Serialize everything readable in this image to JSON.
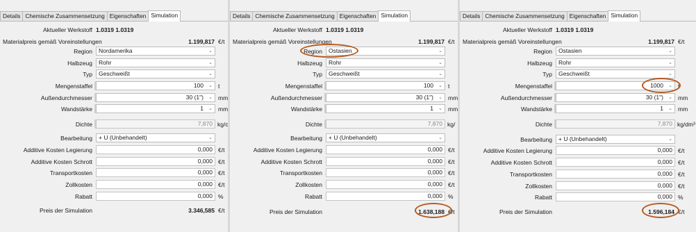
{
  "tabs": [
    "Details",
    "Chemische Zusammensetzung",
    "Eigenschaften",
    "Simulation"
  ],
  "labels": {
    "werkstoff": "Aktueller Werkstoff",
    "materialpreis": "Materialpreis gemäß Voreinstellungen",
    "region": "Region",
    "halbzeug": "Halbzeug",
    "typ": "Typ",
    "mengenstaffel": "Mengenstaffel",
    "aussendurchmesser": "Außendurchmesser",
    "wandstaerke": "Wandstärke",
    "dichte": "Dichte",
    "bearbeitung": "Bearbeitung",
    "add_legierung": "Additive Kosten Legierung",
    "add_schrott": "Additive Kosten Schrott",
    "transport": "Transportkosten",
    "zoll": "Zollkosten",
    "rabatt": "Rabatt",
    "preis_sim": "Preis der Simulation"
  },
  "units": {
    "eur_t": "€/t",
    "t": "t",
    "mm": "mm",
    "pct": "%"
  },
  "panels": [
    {
      "werkstoff": "1.0319 1.0319",
      "materialpreis": "1.199,817",
      "region": "Nordamerika",
      "halbzeug": "Rohr",
      "typ": "Geschweißt",
      "mengenstaffel": "100",
      "aussendurchmesser": "30 (1\")",
      "wandstaerke": "1",
      "dichte": "7,870",
      "dichte_unit": "kg/c",
      "bearbeitung": "+ U (Unbehandelt)",
      "add_legierung": "0,000",
      "add_schrott": "0,000",
      "transport": "0,000",
      "zoll": "0,000",
      "rabatt": "0,000",
      "preis_sim": "3.346,585",
      "preis_unit": "€/t"
    },
    {
      "werkstoff": "1.0319 1.0319",
      "materialpreis": "1.199,817",
      "region": "Ostasien",
      "halbzeug": "Rohr",
      "typ": "Geschweißt",
      "mengenstaffel": "100",
      "aussendurchmesser": "30 (1\")",
      "wandstaerke": "1",
      "dichte": "7,870",
      "dichte_unit": "kg/",
      "bearbeitung": "+ U (Unbehandelt)",
      "add_legierung": "0,000",
      "add_schrott": "0,000",
      "transport": "0,000",
      "zoll": "0,000",
      "rabatt": "0,000",
      "preis_sim": "1.638,188",
      "preis_unit": "€/t"
    },
    {
      "werkstoff": "1.0319 1.0319",
      "materialpreis": "1.199,817",
      "region": "Ostasien",
      "halbzeug": "Rohr",
      "typ": "Geschweißt",
      "mengenstaffel": "1000",
      "aussendurchmesser": "30 (1\")",
      "wandstaerke": "1",
      "dichte": "7,870",
      "dichte_unit": "kg/dm³",
      "bearbeitung": "+ U (Unbehandelt)",
      "add_legierung": "0,000",
      "add_schrott": "0,000",
      "transport": "0,000",
      "zoll": "0,000",
      "rabatt": "0,000",
      "preis_sim": "1.596,184",
      "preis_unit": "€/t"
    }
  ],
  "highlight_color": "#b55a1e"
}
